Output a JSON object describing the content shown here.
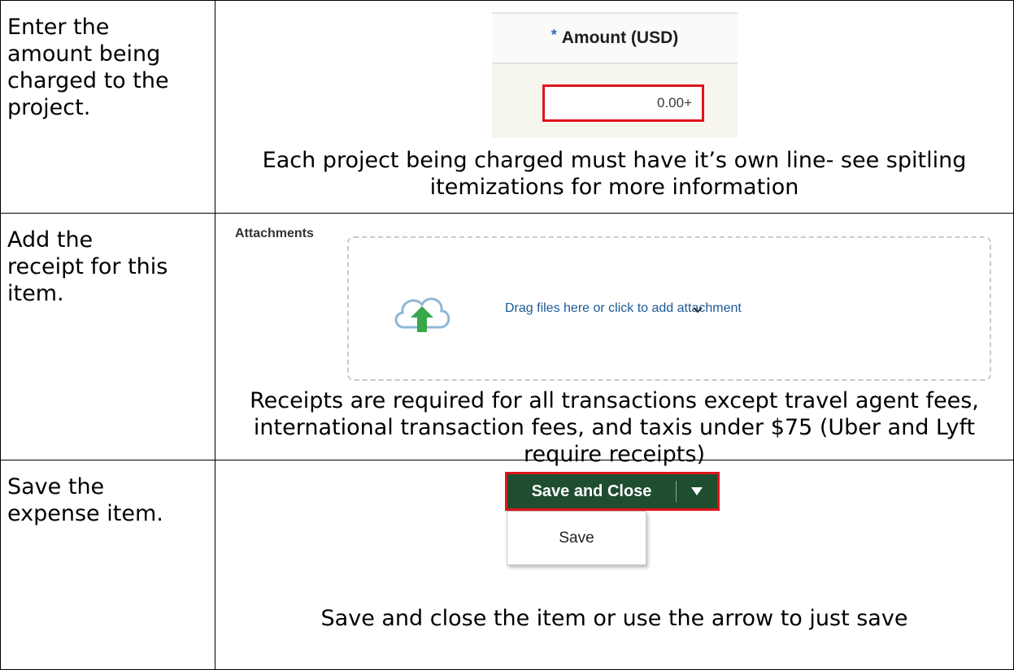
{
  "rows": [
    {
      "step": "Enter the\namount being\ncharged to the\nproject.",
      "caption": "Each project being charged must have it’s own line- see spitling itemizations for more information"
    },
    {
      "step": "Add the\nreceipt for this\nitem.",
      "caption": "Receipts are required for all transactions except travel agent fees, international transaction fees, and taxis under $75 (Uber and Lyft require receipts)"
    },
    {
      "step": "Save the\nexpense item.",
      "caption": "Save and close the item or use the arrow to just save"
    }
  ],
  "amount": {
    "required_mark": "*",
    "header": "Amount (USD)",
    "value": "0.00+"
  },
  "attachments": {
    "label": "Attachments",
    "dropzone_text": "Drag files here or click to add attachment",
    "icon": "cloud-upload-icon"
  },
  "save": {
    "primary_label": "Save and Close",
    "menu_item": "Save",
    "brand_color": "#1f4d30",
    "highlight_color": "#e0141b"
  }
}
